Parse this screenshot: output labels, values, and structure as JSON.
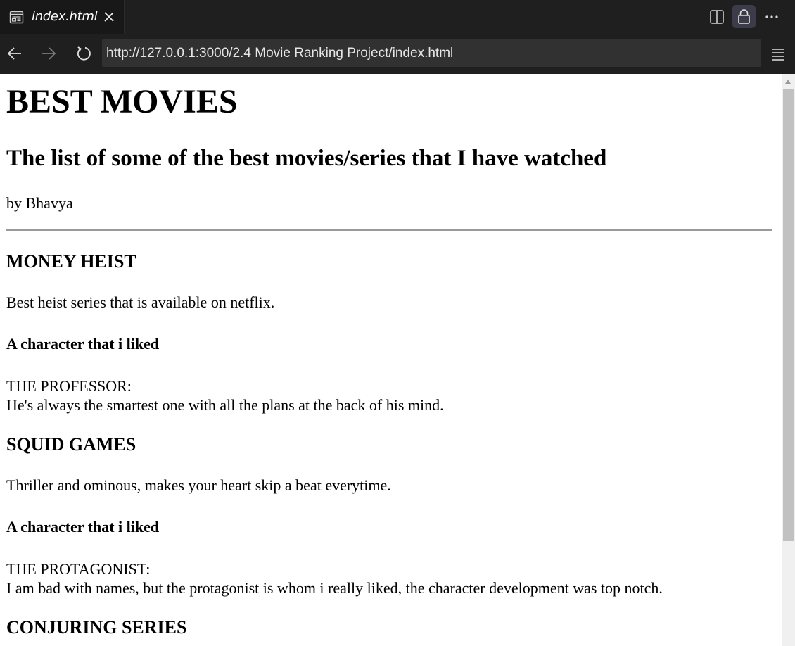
{
  "browser": {
    "tab_title": "index.html",
    "url": "http://127.0.0.1:3000/2.4 Movie Ranking Project/index.html"
  },
  "page": {
    "title": "BEST MOVIES",
    "subtitle": "The list of some of the best movies/series that I have watched",
    "author": "by Bhavya",
    "movies": [
      {
        "name": "MONEY HEIST",
        "description": "Best heist series that is available on netflix.",
        "character_heading": "A character that i liked",
        "character_name": "THE PROFESSOR:",
        "character_reason": "He's always the smartest one with all the plans at the back of his mind."
      },
      {
        "name": "SQUID GAMES",
        "description": "Thriller and ominous, makes your heart skip a beat everytime.",
        "character_heading": "A character that i liked",
        "character_name": "THE PROTAGONIST:",
        "character_reason": "I am bad with names, but the protagonist is whom i really liked, the character development was top notch."
      },
      {
        "name": "CONJURING SERIES"
      }
    ]
  }
}
